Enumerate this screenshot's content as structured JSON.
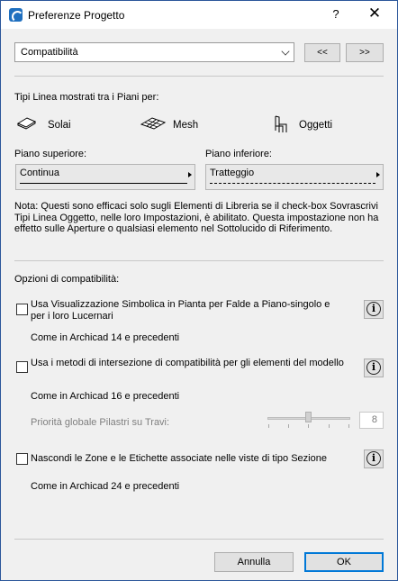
{
  "window": {
    "title": "Preferenze Progetto",
    "help": "?",
    "close": "✕"
  },
  "top": {
    "dropdown_value": "Compatibilità",
    "prev": "<<",
    "next": ">>"
  },
  "line_types": {
    "heading": "Tipi Linea mostrati tra i Piani per:",
    "solai": "Solai",
    "mesh": "Mesh",
    "oggetti": "Oggetti",
    "upper_label": "Piano superiore:",
    "upper_value": "Continua",
    "lower_label": "Piano inferiore:",
    "lower_value": "Tratteggio",
    "note": "Nota: Questi sono efficaci solo sugli Elementi di Libreria se il check-box Sovrascrivi Tipi Linea Oggetto, nelle loro Impostazioni, è abilitato. Questa impostazione non ha effetto sulle Aperture o qualsiasi elemento nel Sottolucido di Riferimento."
  },
  "compat": {
    "heading": "Opzioni di compatibilità:",
    "opt1": {
      "label": "Usa Visualizzazione Simbolica in Pianta per Falde a Piano-singolo e per i loro Lucernari",
      "sub": "Come in Archicad 14 e precedenti",
      "checked": false
    },
    "opt2": {
      "label": "Usa i metodi di intersezione di compatibilità per gli elementi del modello",
      "sub": "Come in Archicad 16 e precedenti",
      "checked": false
    },
    "priority": {
      "label": "Priorità globale Pilastri su Travi:",
      "value": "8",
      "level": 8,
      "max": 16
    },
    "opt3": {
      "label": "Nascondi le Zone e le Etichette associate nelle viste di tipo Sezione",
      "sub": "Come in Archicad 24 e precedenti",
      "checked": false
    },
    "info": "i"
  },
  "footer": {
    "cancel": "Annulla",
    "ok": "OK"
  }
}
